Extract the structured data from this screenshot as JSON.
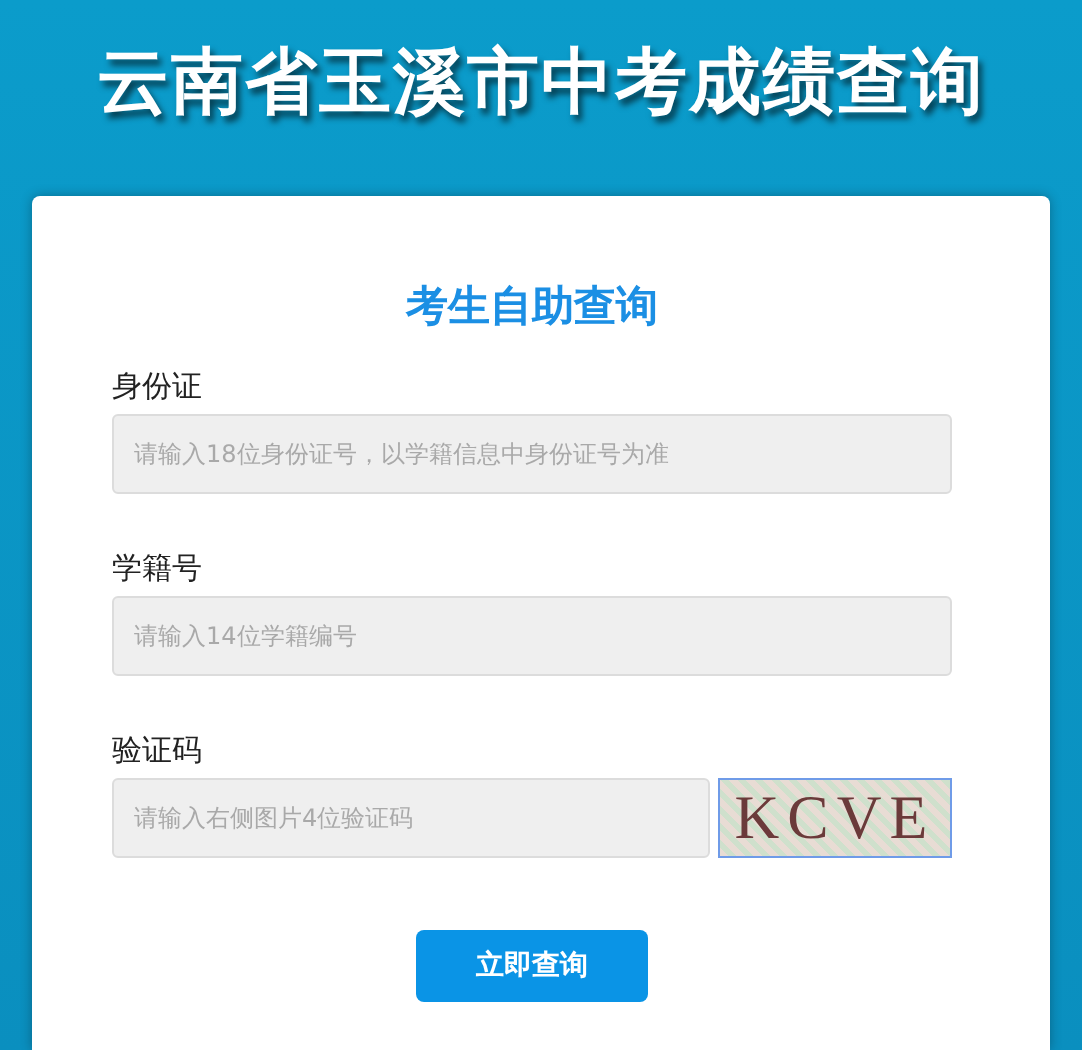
{
  "page_title": "云南省玉溪市中考成绩查询",
  "form": {
    "title": "考生自助查询",
    "fields": [
      {
        "kind": "text",
        "label": "身份证",
        "placeholder": "请输入18位身份证号，以学籍信息中身份证号为准"
      },
      {
        "kind": "text",
        "label": "学籍号",
        "placeholder": "请输入14位学籍编号"
      },
      {
        "kind": "captcha",
        "label": "验证码",
        "placeholder": "请输入右侧图片4位验证码",
        "captcha": "KCVE"
      }
    ],
    "submit": "立即查询"
  }
}
